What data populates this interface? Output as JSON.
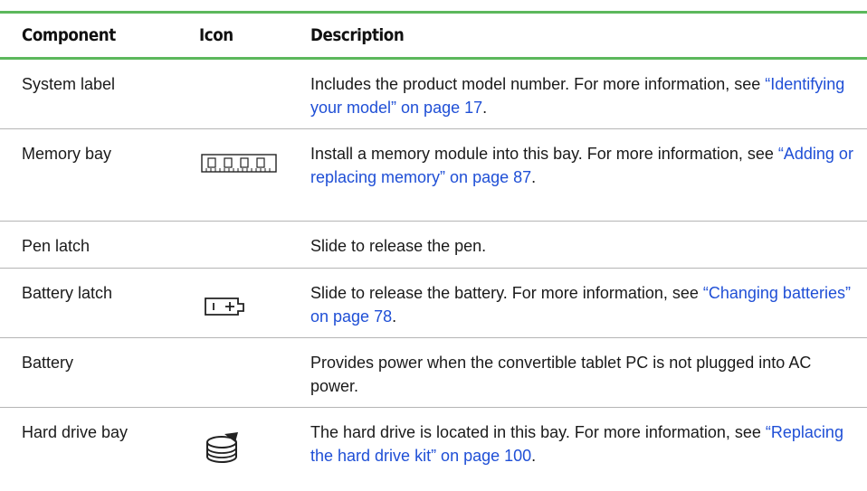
{
  "header": {
    "component": "Component",
    "icon": "Icon",
    "description": "Description"
  },
  "rows": [
    {
      "component": "System label",
      "icon": "",
      "desc_text": "Includes the product model number. For more information, see ",
      "desc_link": "“Identifying your model” on page 17",
      "desc_end": "."
    },
    {
      "component": "Memory bay",
      "icon": "memory-module-icon",
      "desc_text": "Install a memory module into this bay. For more information, see ",
      "desc_link": "“Adding or replacing memory” on page 87",
      "desc_end": "."
    },
    {
      "component": "Pen latch",
      "icon": "",
      "desc_text": "Slide to release the pen.",
      "desc_link": "",
      "desc_end": ""
    },
    {
      "component": "Battery latch",
      "icon": "battery-icon",
      "desc_text": "Slide to release the battery. For more information, see ",
      "desc_link": "“Changing batteries” on page 78",
      "desc_end": "."
    },
    {
      "component": "Battery",
      "icon": "",
      "desc_text": "Provides power when the convertible tablet PC is not plugged into AC power.",
      "desc_link": "",
      "desc_end": ""
    },
    {
      "component": "Hard drive bay",
      "icon": "hard-drive-icon",
      "desc_text": "The hard drive is located in this bay. For more information, see ",
      "desc_link": "“Replacing the hard drive kit” on page 100",
      "desc_end": "."
    }
  ],
  "colors": {
    "rule": "#5cb85c",
    "link": "#1f4fd6",
    "divider": "#b5b5b5"
  }
}
